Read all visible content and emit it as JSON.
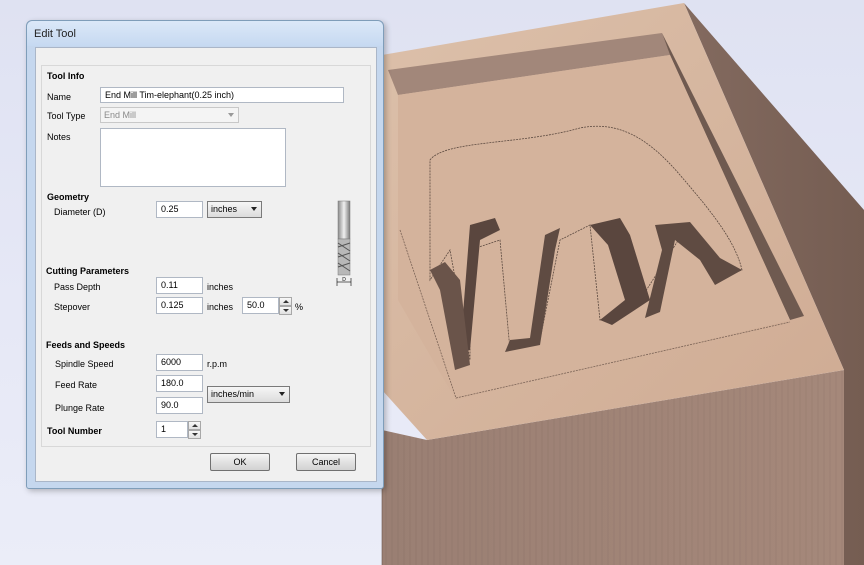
{
  "dialog": {
    "title": "Edit Tool",
    "ok_label": "OK",
    "cancel_label": "Cancel"
  },
  "tool_info": {
    "heading": "Tool Info",
    "name_label": "Name",
    "name_value": "End Mill Tim-elephant(0.25 inch)",
    "type_label": "Tool Type",
    "type_value": "End Mill",
    "notes_label": "Notes",
    "notes_value": ""
  },
  "geometry": {
    "heading": "Geometry",
    "diameter_label": "Diameter (D)",
    "diameter_value": "0.25",
    "units_value": "inches",
    "diagram_label": "D"
  },
  "cutting": {
    "heading": "Cutting Parameters",
    "pass_depth_label": "Pass Depth",
    "pass_depth_value": "0.11",
    "pass_depth_unit": "inches",
    "stepover_label": "Stepover",
    "stepover_value": "0.125",
    "stepover_unit": "inches",
    "stepover_percent": "50.0",
    "percent_sign": "%"
  },
  "feeds": {
    "heading": "Feeds and Speeds",
    "spindle_label": "Spindle Speed",
    "spindle_value": "6000",
    "spindle_unit": "r.p.m",
    "feed_label": "Feed Rate",
    "feed_value": "180.0",
    "plunge_label": "Plunge Rate",
    "plunge_value": "90.0",
    "rate_units": "inches/min"
  },
  "tool_number": {
    "label": "Tool Number",
    "value": "1"
  },
  "colors": {
    "wood_top": "#d8b7a0",
    "wood_side": "#9c8072",
    "dialog_frame": "#c5d7ee"
  }
}
